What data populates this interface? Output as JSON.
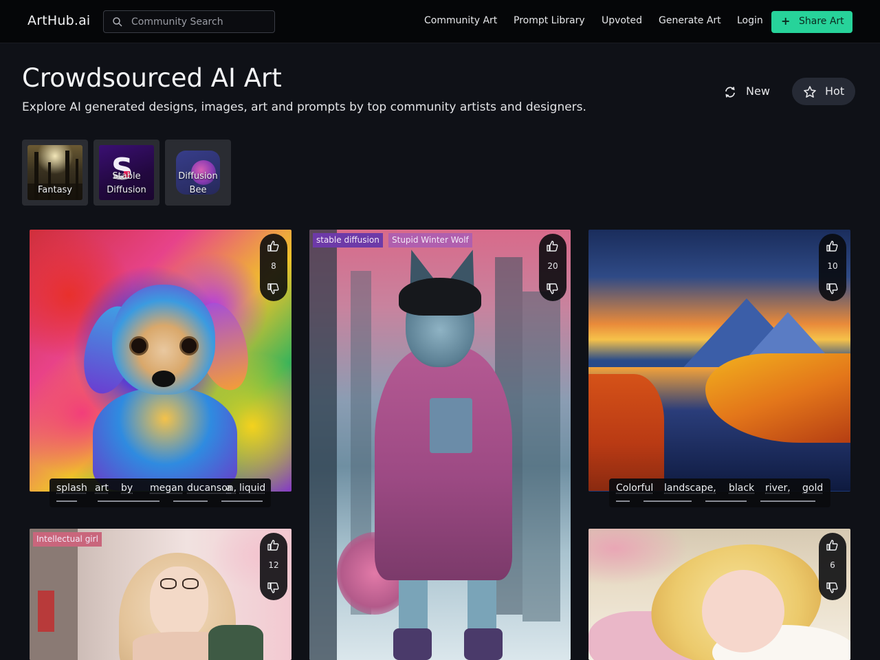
{
  "brand": "ArtHub.ai",
  "search": {
    "placeholder": "Community Search"
  },
  "nav": {
    "items": [
      "Community Art",
      "Prompt Library",
      "Upvoted",
      "Generate Art",
      "Login"
    ],
    "share_label": "Share Art"
  },
  "header": {
    "title": "Crowdsourced AI Art",
    "subtitle": "Explore AI generated designs, images, art and prompts by top community artists and designers."
  },
  "sort": {
    "new_label": "New",
    "hot_label": "Hot",
    "active": "Hot"
  },
  "categories": [
    {
      "line1": "",
      "line2": "Fantasy"
    },
    {
      "line1": "Stable",
      "line2": "Diffusion"
    },
    {
      "line1": "Diffusion",
      "line2": "Bee"
    }
  ],
  "cards": [
    {
      "votes": "8",
      "tags": [],
      "caption_words": [
        "splash",
        "art",
        "by",
        "megan",
        "ducanson,",
        "a",
        "liquid"
      ],
      "image": "puppy"
    },
    {
      "votes": "20",
      "tags": [
        "stable diffusion",
        "Stupid Winter Wolf"
      ],
      "caption_words": [],
      "image": "wolf"
    },
    {
      "votes": "10",
      "tags": [],
      "caption_words": [
        "Colorful",
        "landscape,",
        "black",
        "river,",
        "gold"
      ],
      "image": "landscape"
    },
    {
      "votes": "12",
      "tags": [
        "Intellectual girl"
      ],
      "caption_words": [],
      "image": "girl"
    },
    {
      "votes": "6",
      "tags": [],
      "caption_words": [],
      "image": "sleeping"
    }
  ],
  "colors": {
    "accent": "#27d39a",
    "background": "#0f1117",
    "topbar": "#050608",
    "tag_stable_diffusion": "#6d3aa8",
    "tag_winter_wolf": "#b05fae",
    "tag_intellectual_girl": "#c9667c"
  },
  "icons": {
    "search": "search-icon",
    "new": "refresh-icon",
    "hot": "star-icon",
    "upvote": "thumbs-up-icon",
    "downvote": "thumbs-down-icon",
    "share": "plus-icon"
  }
}
